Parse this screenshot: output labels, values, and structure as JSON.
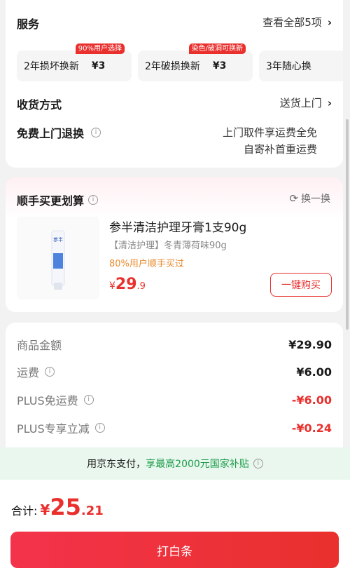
{
  "services": {
    "title": "服务",
    "view_all": "查看全部5项",
    "options": [
      {
        "name": "2年损坏换新",
        "price": "¥3",
        "tag": "90%用户选择"
      },
      {
        "name": "2年破损换新",
        "price": "¥3",
        "tag": "染色/破洞可换新"
      },
      {
        "name": "3年随心换",
        "price": "",
        "tag": ""
      }
    ]
  },
  "delivery": {
    "label": "收货方式",
    "value": "送货上门"
  },
  "free_return": {
    "label": "免费上门退换",
    "line1": "上门取件享运费全免",
    "line2": "自寄补首重运费"
  },
  "bundle": {
    "title": "顺手买更划算",
    "refresh": "换一换",
    "product": {
      "name": "参半清洁护理牙膏1支90g",
      "spec": "【清洁护理】冬青薄荷味90g",
      "social": "80%用户顺手买过",
      "price_symbol": "¥",
      "price_int": "29",
      "price_dec": ".9",
      "buy_label": "一键购买",
      "image_brand": "参半"
    }
  },
  "price": {
    "rows": [
      {
        "label": "商品金额",
        "value": "¥29.90",
        "info": false,
        "red": false
      },
      {
        "label": "运费",
        "value": "¥6.00",
        "info": true,
        "red": false
      },
      {
        "label": "PLUS免运费",
        "value": "-¥6.00",
        "info": true,
        "red": true
      },
      {
        "label": "PLUS专享立减",
        "value": "-¥0.24",
        "info": true,
        "red": true
      }
    ]
  },
  "banner": {
    "prefix": "用京东支付，",
    "highlight": "享最高2000元国家补贴"
  },
  "total": {
    "label": "合计:",
    "symbol": "¥",
    "int": "25",
    "dec": ".21"
  },
  "pay_button": "打白条",
  "colors": {
    "accent_red": "#e9302d",
    "social_orange": "#e88a2e",
    "banner_green": "#1b9c4a"
  }
}
